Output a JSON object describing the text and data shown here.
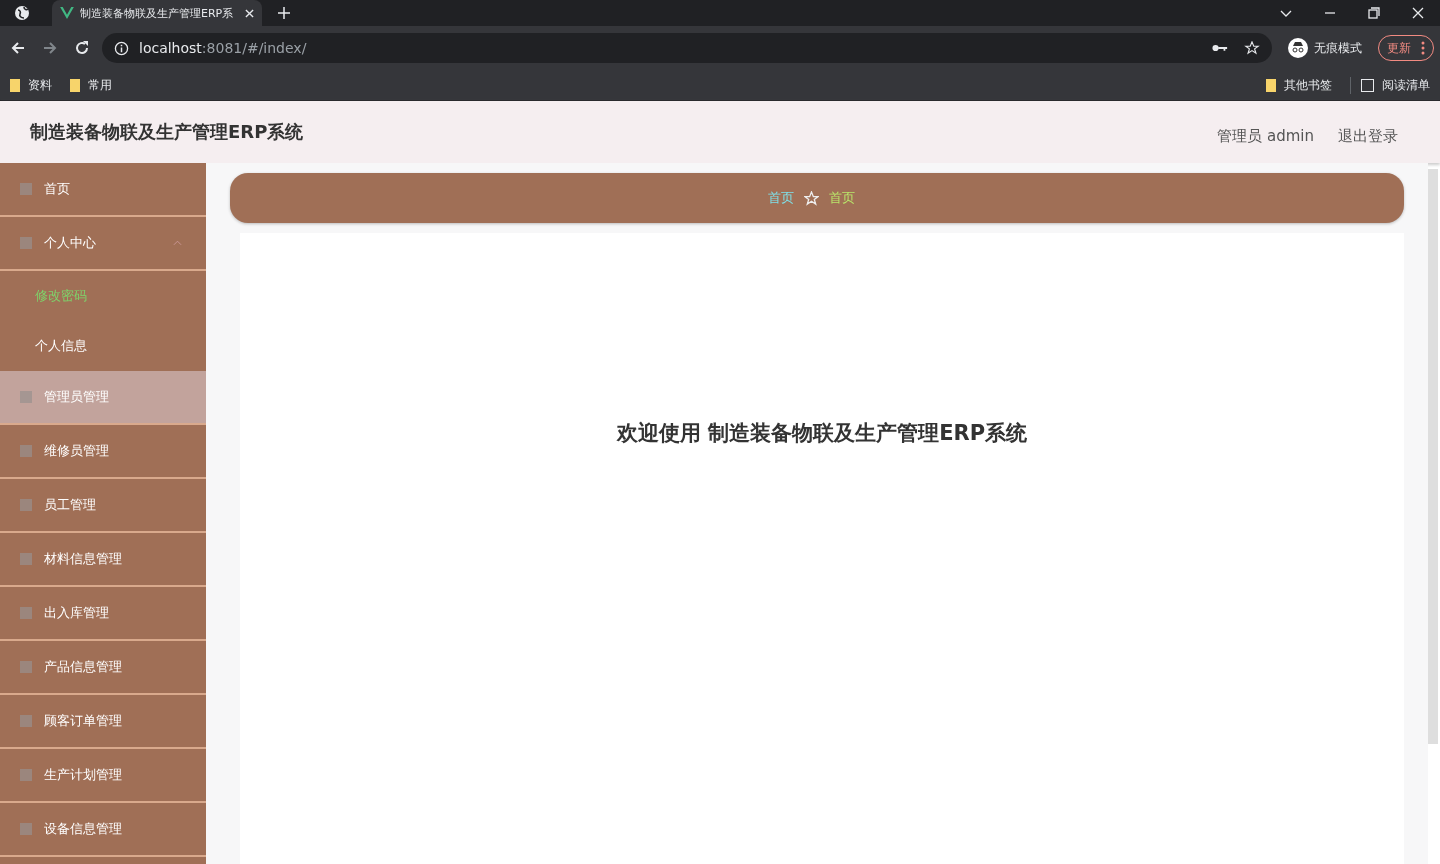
{
  "browser": {
    "tab_title": "制造装备物联及生产管理ERP系",
    "url_host": "localhost",
    "url_rest": ":8081/#/index/",
    "profile": "无痕模式",
    "update_button": "更新",
    "bookmarks": [
      "资料",
      "常用"
    ],
    "other_bookmarks": "其他书签",
    "reading_list": "阅读清单"
  },
  "header": {
    "title": "制造装备物联及生产管理ERP系统",
    "user": "管理员 admin",
    "logout": "退出登录"
  },
  "sidebar": {
    "items": [
      {
        "label": "首页",
        "hovered": false
      },
      {
        "label": "个人中心",
        "hovered": false,
        "expanded": true,
        "children": [
          {
            "label": "修改密码",
            "selected": true
          },
          {
            "label": "个人信息",
            "selected": false
          }
        ]
      },
      {
        "label": "管理员管理",
        "hovered": true
      },
      {
        "label": "维修员管理",
        "hovered": false
      },
      {
        "label": "员工管理",
        "hovered": false
      },
      {
        "label": "材料信息管理",
        "hovered": false
      },
      {
        "label": "出入库管理",
        "hovered": false
      },
      {
        "label": "产品信息管理",
        "hovered": false
      },
      {
        "label": "顾客订单管理",
        "hovered": false
      },
      {
        "label": "生产计划管理",
        "hovered": false
      },
      {
        "label": "设备信息管理",
        "hovered": false
      }
    ]
  },
  "breadcrumb": [
    "首页",
    "首页"
  ],
  "welcome": "欢迎使用 制造装备物联及生产管理ERP系统"
}
